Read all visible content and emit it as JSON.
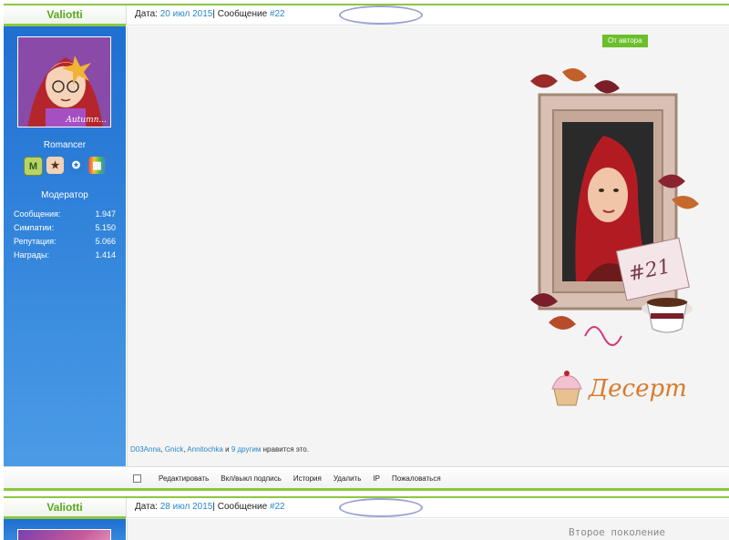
{
  "posts": [
    {
      "author": "Valiotti",
      "date_label": "Дата:",
      "date": "20 июл 2015",
      "separator": "|",
      "message_label": "Сообщение",
      "message_num": "#22",
      "avatar_caption": "Autumn...",
      "user_title": "Romancer",
      "badges": [
        "M",
        "★",
        "✪",
        "▦"
      ],
      "role": "Модератор",
      "stats": [
        {
          "label": "Сообщения:",
          "value": "1.947"
        },
        {
          "label": "Симпатии:",
          "value": "5.150"
        },
        {
          "label": "Репутация:",
          "value": "5.066"
        },
        {
          "label": "Награды:",
          "value": "1.414"
        }
      ],
      "from_author": "От автора",
      "artwork_number": "#21",
      "dessert_label": "Десерт",
      "likes": {
        "users": [
          "D03Anna",
          "Gnick",
          "Annitochka"
        ],
        "and_label": "и",
        "others": "9 другим",
        "suffix": "нравится это."
      },
      "controls": [
        "Редактировать",
        "Вкл/выкл подпись",
        "История",
        "Удалить",
        "IP",
        "Пожаловаться"
      ]
    },
    {
      "author": "Valiotti",
      "date_label": "Дата:",
      "date": "28 июл 2015",
      "separator": "|",
      "message_label": "Сообщение",
      "message_num": "#22",
      "content_preview": "Второе поколение"
    }
  ],
  "colors": {
    "accent_green": "#8cc63f",
    "link_blue": "#2b87c9",
    "panel_blue": "#1e6fd1",
    "oval_highlight": "#9aa2d4"
  },
  "icons": [
    "checkbox-icon",
    "cupcake-icon",
    "teacup-icon",
    "moderator-badge-icon",
    "friends-badge-icon",
    "globe-badge-icon",
    "chart-badge-icon"
  ]
}
